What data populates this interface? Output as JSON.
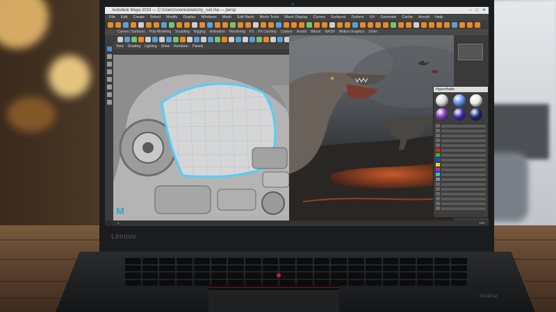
{
  "device": {
    "brand": "Lenovo",
    "badge": "ThinkPad"
  },
  "window": {
    "title": "Autodesk Maya 2019 — C:/Users/scene/anatomy_suit.ma — persp"
  },
  "menus": [
    "File",
    "Edit",
    "Create",
    "Select",
    "Modify",
    "Display",
    "Windows",
    "Mesh",
    "Edit Mesh",
    "Mesh Tools",
    "Mesh Display",
    "Curves",
    "Surfaces",
    "Deform",
    "UV",
    "Generate",
    "Cache",
    "Arnold",
    "Help"
  ],
  "shelf_tabs": [
    "Curves / Surfaces",
    "Poly Modeling",
    "Sculpting",
    "Rigging",
    "Animation",
    "Rendering",
    "FX",
    "FX Caching",
    "Custom",
    "Arnold",
    "Bifrost",
    "MASH",
    "Motion Graphics",
    "XGen"
  ],
  "viewport_left": {
    "menus": [
      "View",
      "Shading",
      "Lighting",
      "Show",
      "Renderer",
      "Panels"
    ]
  },
  "logo": {
    "letter": "M"
  },
  "hypershade": {
    "title": "Hypershade",
    "swatches": [
      "#d8d8d8",
      "#5a8ff0",
      "#e8e8e8",
      "#7a3ab8",
      "#3c2aa8",
      "#1a2a6a"
    ],
    "row_colors": [
      "#e02020",
      "#28c028",
      "#2040e8",
      "#e8d820",
      "#c020c0",
      "#20c8d8",
      "#888888"
    ]
  },
  "timeslider": {
    "start": "1",
    "end": "120"
  }
}
